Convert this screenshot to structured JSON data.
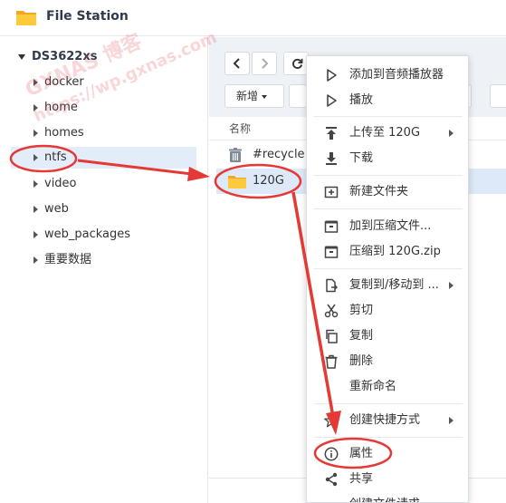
{
  "app": {
    "title": "File Station",
    "accent": "#f5a623"
  },
  "sidebar": {
    "root": "DS3622xs",
    "items": [
      {
        "label": "docker"
      },
      {
        "label": "home"
      },
      {
        "label": "homes"
      },
      {
        "label": "ntfs",
        "selected": true
      },
      {
        "label": "video"
      },
      {
        "label": "web"
      },
      {
        "label": "web_packages"
      },
      {
        "label": "重要数据"
      }
    ]
  },
  "toolbar": {
    "new_label": "新增"
  },
  "list": {
    "column_name": "名称",
    "files": [
      {
        "name": "#recycle",
        "icon": "trash-icon"
      },
      {
        "name": "120G",
        "icon": "folder-icon",
        "selected": true
      }
    ]
  },
  "context_menu": {
    "items": [
      {
        "label": "添加到音频播放器",
        "icon": "play-icon"
      },
      {
        "label": "播放",
        "icon": "play-icon"
      },
      {
        "label": "上传至 120G",
        "icon": "upload-icon",
        "submenu": true
      },
      {
        "label": "下载",
        "icon": "download-icon"
      },
      {
        "label": "新建文件夹",
        "icon": "new-folder-icon"
      },
      {
        "label": "加到压缩文件...",
        "icon": "archive-icon"
      },
      {
        "label": "压缩到 120G.zip",
        "icon": "archive-icon"
      },
      {
        "label": "复制到/移动到 ...",
        "icon": "copy-move-icon",
        "submenu": true
      },
      {
        "label": "剪切",
        "icon": "scissors-icon"
      },
      {
        "label": "复制",
        "icon": "copy-icon"
      },
      {
        "label": "删除",
        "icon": "trash-icon"
      },
      {
        "label": "重新命名",
        "icon": ""
      },
      {
        "label": "创建快捷方式",
        "icon": "star-icon",
        "submenu": true
      },
      {
        "label": "属性",
        "icon": "info-icon"
      },
      {
        "label": "共享",
        "icon": "share-icon"
      },
      {
        "label": "创建文件请求",
        "icon": ""
      }
    ]
  },
  "watermark": {
    "line1": "GXNAS 博客",
    "line2": "https://wp.gxnas.com"
  },
  "annotation_color": "#e53935"
}
